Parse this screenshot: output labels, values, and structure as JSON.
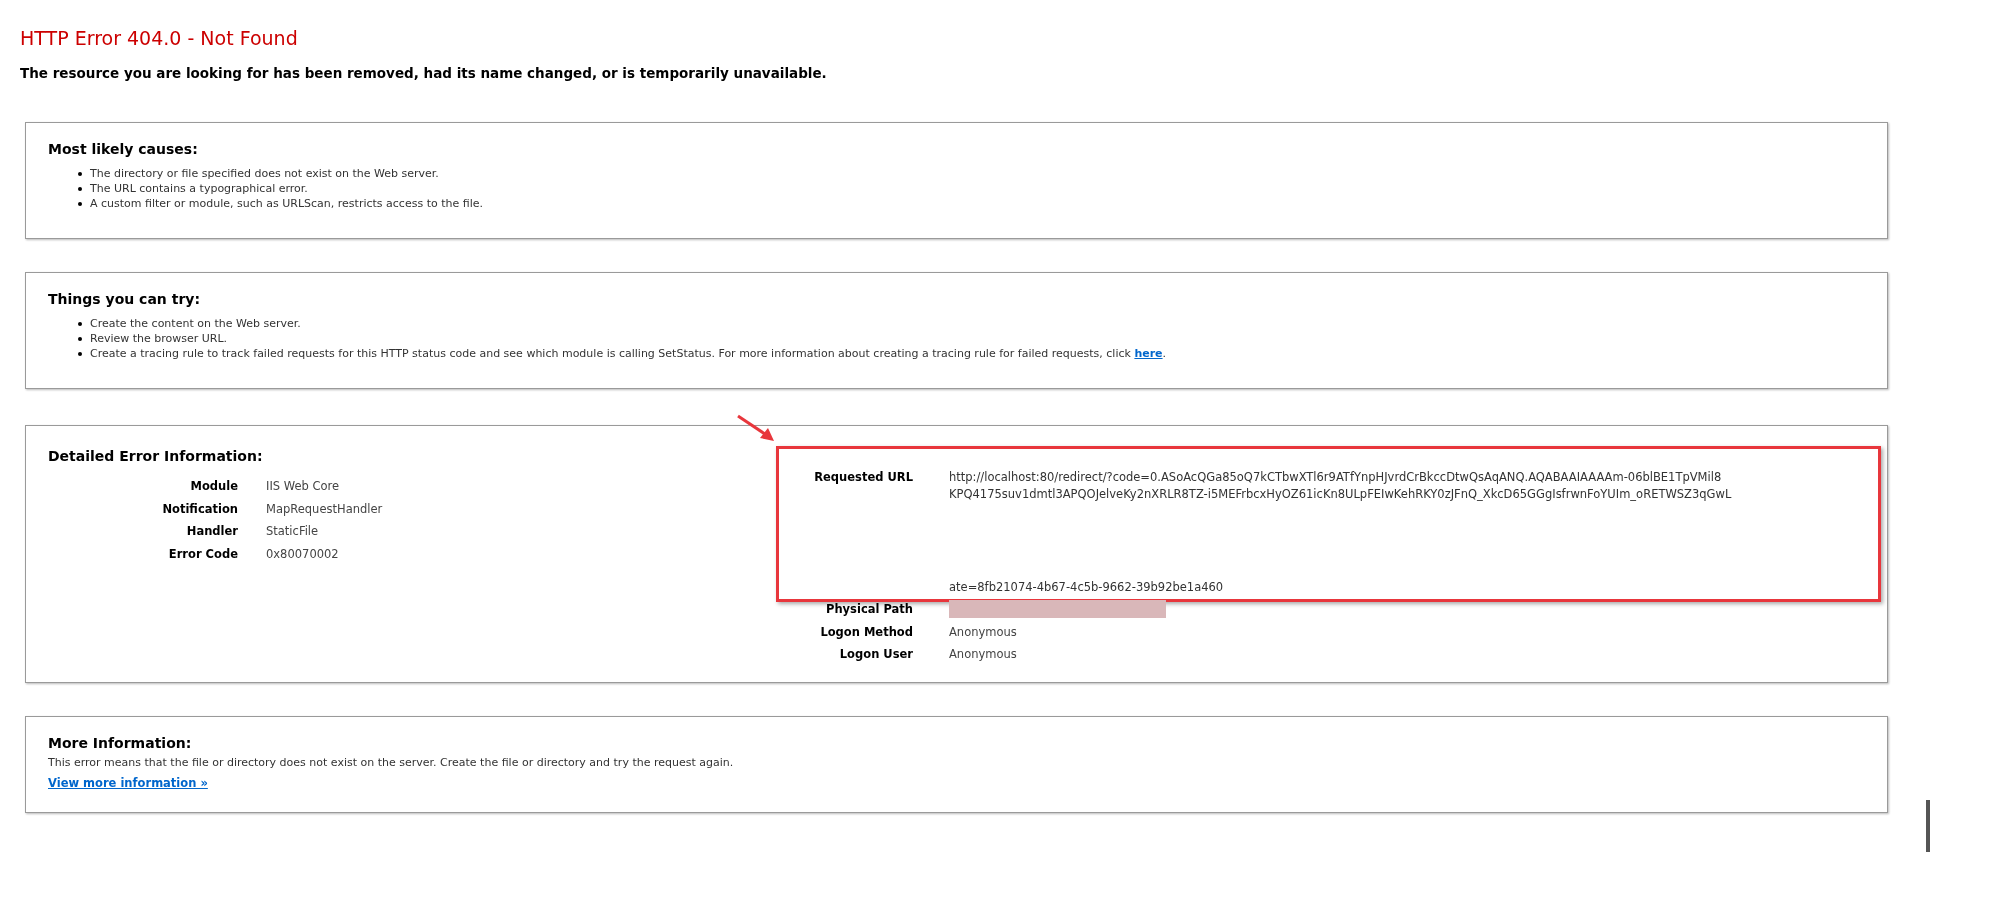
{
  "title": "HTTP Error 404.0 - Not Found",
  "subtitle": "The resource you are looking for has been removed, had its name changed, or is temporarily unavailable.",
  "causes": {
    "heading": "Most likely causes:",
    "items": [
      "The directory or file specified does not exist on the Web server.",
      "The URL contains a typographical error.",
      "A custom filter or module, such as URLScan, restricts access to the file."
    ]
  },
  "try": {
    "heading": "Things you can try:",
    "items": [
      {
        "text": "Create the content on the Web server."
      },
      {
        "text": "Review the browser URL."
      },
      {
        "text": "Create a tracing rule to track failed requests for this HTTP status code and see which module is calling SetStatus. For more information about creating a tracing rule for failed requests, click ",
        "link": "here",
        "after": "."
      }
    ]
  },
  "details": {
    "heading": "Detailed Error Information:",
    "left": [
      {
        "label": "Module",
        "value": "IIS Web Core"
      },
      {
        "label": "Notification",
        "value": "MapRequestHandler"
      },
      {
        "label": "Handler",
        "value": "StaticFile"
      },
      {
        "label": "Error Code",
        "value": "0x80070002"
      }
    ],
    "requested_url": {
      "label": "Requested URL",
      "lines": [
        "http://localhost:80/redirect/?code=0.ASoAcQGa85oQ7kCTbwXTl6r9ATfYnpHJvrdCrBkccDtwQsAqANQ.AQABAAIAAAAm-06blBE1TpVMil8",
        "KPQ4175suv1dmtl3APQOJelveKy2nXRLR8TZ-i5MEFrbcxHyOZ61icKn8ULpFEIwKehRKY0zJFnQ_XkcD65GGgIsfrwnFoYUIm_oRETWSZ3qGwL",
        "ate=8fb21074-4b67-4c5b-9662-39b92be1a460"
      ]
    },
    "right": [
      {
        "label": "Physical Path",
        "redacted": true
      },
      {
        "label": "Logon Method",
        "value": "Anonymous",
        "redacted": false
      },
      {
        "label": "Logon User",
        "value": "Anonymous",
        "redacted": false
      }
    ]
  },
  "more": {
    "heading": "More Information:",
    "text": "This error means that the file or directory does not exist on the server. Create the file or directory and try the request again.",
    "link": "View more information »"
  }
}
